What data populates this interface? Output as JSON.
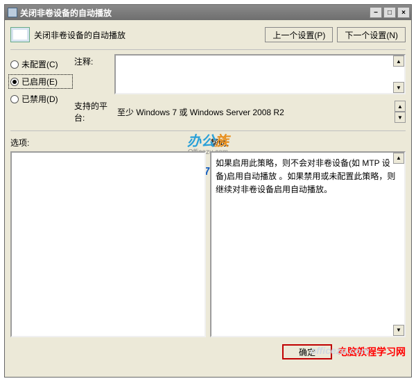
{
  "titlebar": {
    "title": "关闭非卷设备的自动播放",
    "min": "−",
    "max": "□",
    "close": "×"
  },
  "header": {
    "label": "关闭非卷设备的自动播放",
    "prev_btn": "上一个设置(P)",
    "next_btn": "下一个设置(N)"
  },
  "radios": {
    "not_configured": "未配置(C)",
    "enabled": "已启用(E)",
    "disabled": "已禁用(D)"
  },
  "fields": {
    "comment_label": "注释:",
    "platform_label": "支持的平台:",
    "platform_value": "至少 Windows 7 或 Windows Server 2008 R2"
  },
  "options": {
    "label": "选项:"
  },
  "help": {
    "label": "帮助:",
    "line1": "如果启用此策略，则不会对非卷设备(如 MTP 设备)启用自动播放",
    "line2": "。如果禁用或未配置此策略，则继续对非卷设备启用自动播放。"
  },
  "watermark": {
    "brand1_a": "办公",
    "brand1_b": "族",
    "brand2": "Officezu.com",
    "brand3": "Win7教程",
    "br": "officezu.com"
  },
  "footer": {
    "ok": "确定",
    "link": "电脑教程学习网"
  }
}
